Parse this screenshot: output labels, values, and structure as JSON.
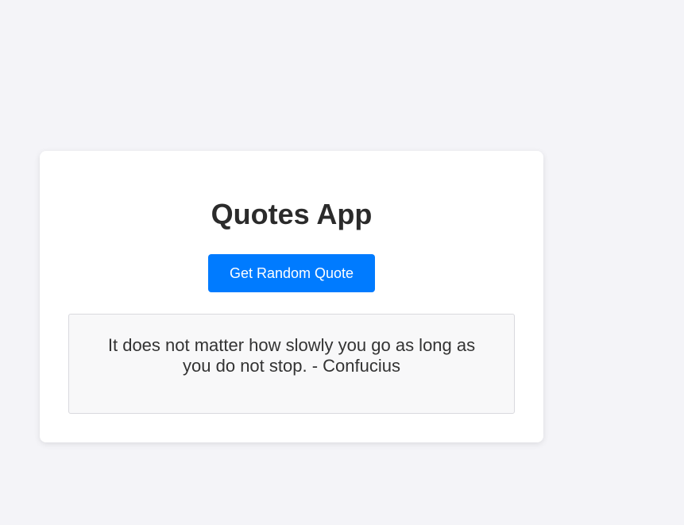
{
  "app": {
    "title": "Quotes App"
  },
  "actions": {
    "random_quote_label": "Get Random Quote"
  },
  "quote": {
    "text": "It does not matter how slowly you go as long as you do not stop. - Confucius"
  },
  "colors": {
    "background": "#f4f4f8",
    "card": "#ffffff",
    "accent": "#007bff",
    "quote_box": "#f8f8f9",
    "text": "#333333"
  }
}
